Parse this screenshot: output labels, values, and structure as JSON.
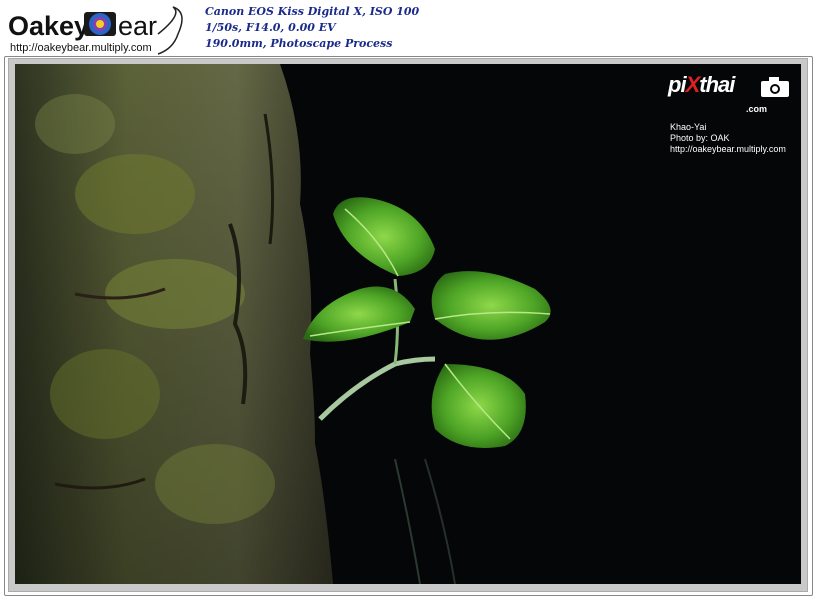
{
  "header": {
    "logo_text": "OakeyBear",
    "logo_url": "http://oakeybear.multiply.com",
    "exif": {
      "line1": "Canon EOS Kiss Digital X, ISO 100",
      "line2": "1/50s, F14.0, 0.00 EV",
      "line3": "190.0mm, Photoscape Process"
    }
  },
  "watermark": {
    "brand_left": "pi",
    "brand_x": "X",
    "brand_right": "thai",
    "brand_suffix": ".com",
    "location": "Khao-Yai",
    "credit": "Photo by: OAK",
    "url": "http://oakeybear.multiply.com"
  },
  "photo": {
    "subject": "green seedling growing from mossy tree trunk",
    "colors": {
      "background": "#050607",
      "leaf": "#4fa02a",
      "bark": "#5d6438"
    }
  }
}
